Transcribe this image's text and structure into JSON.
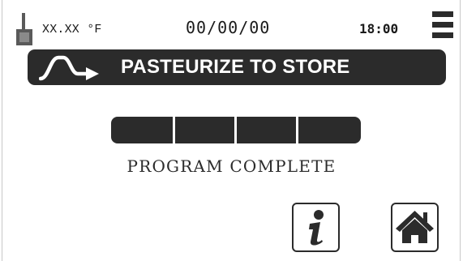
{
  "status_bar": {
    "temperature": "XX.XX °F",
    "date": "00/00/00",
    "time": "18:00",
    "icons": [
      "probe-icon",
      "menu-icon"
    ]
  },
  "banner": {
    "title": "PASTEURIZE TO STORE",
    "icon": "pasteurize-curve-icon"
  },
  "progress": {
    "segments_total": 4,
    "segments_filled": 4,
    "fraction": 1.0,
    "status": "PROGRAM COMPLETE"
  },
  "buttons": {
    "info_icon": "info-icon",
    "home_icon": "home-icon"
  },
  "colors": {
    "foreground": "#2b2b2b",
    "background": "#ffffff",
    "probe_icon": "#5a5a5a"
  }
}
